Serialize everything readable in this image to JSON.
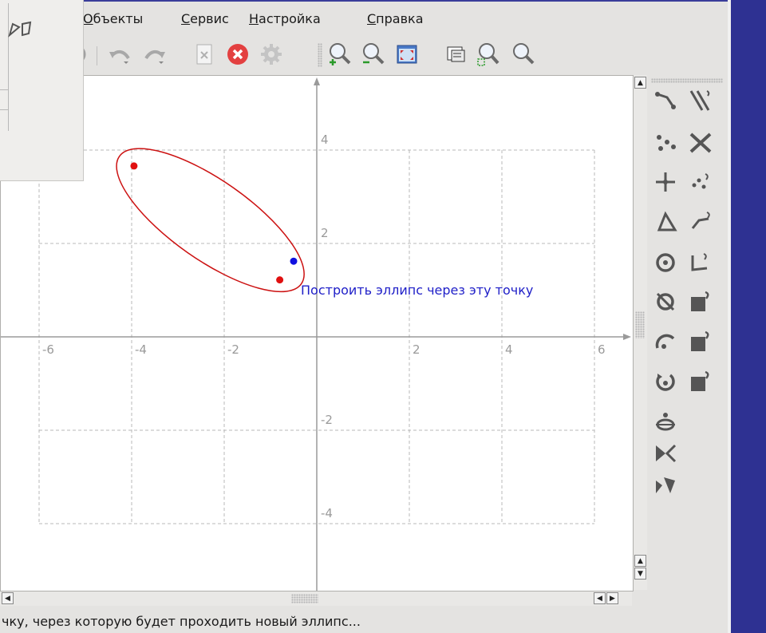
{
  "menu": {
    "items": [
      {
        "accel": "О",
        "rest": "бъекты"
      },
      {
        "accel": "С",
        "rest": "ервис"
      },
      {
        "accel": "Н",
        "rest": "астройка"
      },
      {
        "accel": "С",
        "rest": "правка"
      }
    ]
  },
  "toolbar": {
    "icons": [
      "partial-icon",
      "undo-icon",
      "redo-icon",
      "delete-icon",
      "cancel-icon",
      "settings-icon",
      "zoom-in-icon",
      "zoom-out-icon",
      "fit-screen-icon",
      "select-icon",
      "zoom-area-icon",
      "zoom-icon"
    ]
  },
  "plot": {
    "x_ticks": [
      "-6",
      "-4",
      "-2",
      "2",
      "4",
      "6"
    ],
    "y_ticks": [
      "4",
      "2",
      "-2",
      "-4"
    ],
    "colors": {
      "ellipse": "#cc1111",
      "focus": "#e01010",
      "point": "#1010e0",
      "grid": "#b8b8b8",
      "axis": "#9a9a9a"
    }
  },
  "chart_data": {
    "type": "scatter",
    "xlim": [
      -6.7,
      6.7
    ],
    "ylim": [
      -5.4,
      5.6
    ],
    "grid": true,
    "ellipse": {
      "center": [
        -2.3,
        2.5
      ],
      "semi_axes": [
        2.4,
        0.85
      ],
      "rotation_deg": -35
    },
    "points": [
      {
        "x": -3.95,
        "y": 3.66,
        "color": "#e01010",
        "label": "focus"
      },
      {
        "x": -0.8,
        "y": 1.22,
        "color": "#e01010",
        "label": "focus"
      },
      {
        "x": -0.5,
        "y": 1.62,
        "color": "#1010e0",
        "label": "selected-point"
      }
    ]
  },
  "tooltip": "Построить эллипс через эту точку",
  "status": "чку, через которую будет проходить новый эллипс...",
  "colors": {
    "desktop": "#2e3192",
    "window": "#e4e3e1",
    "tooltip_text": "#2020c8"
  }
}
